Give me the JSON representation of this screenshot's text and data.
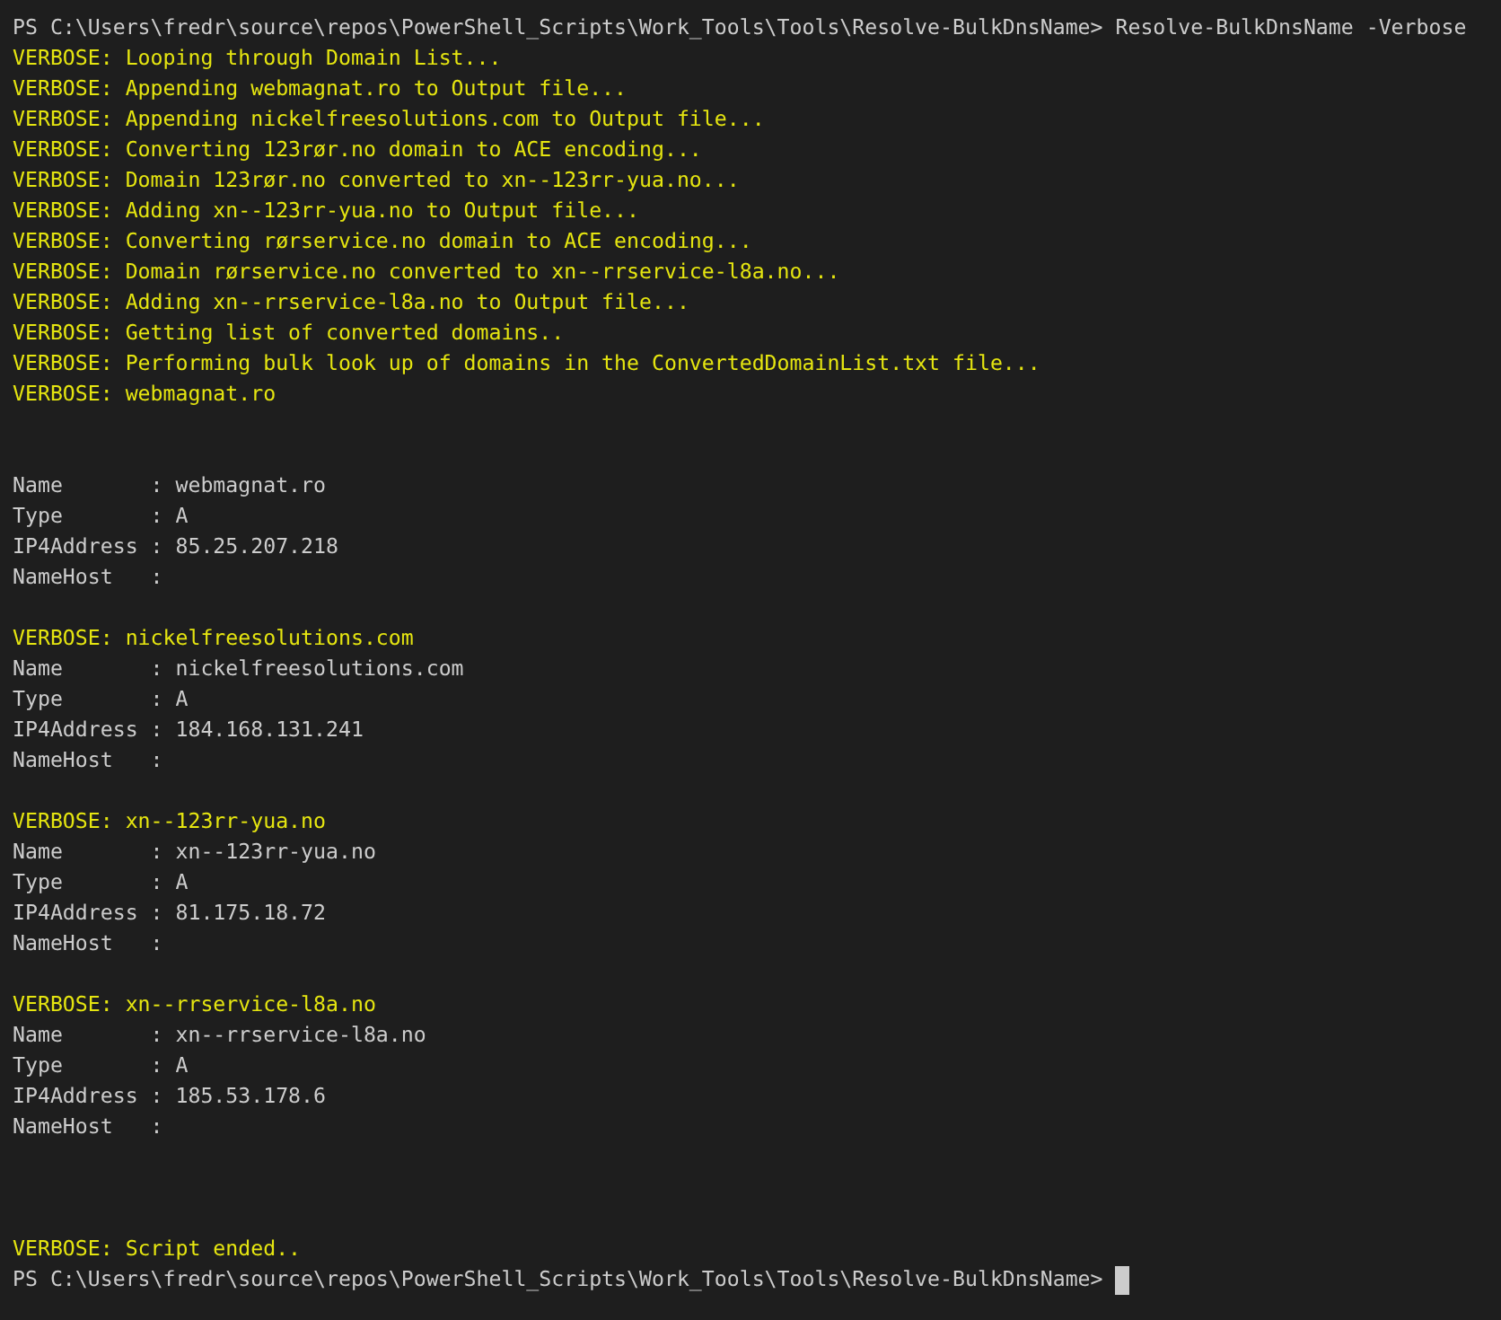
{
  "terminal": {
    "lines": [
      {
        "kind": "prompt",
        "text": "PS C:\\Users\\fredr\\source\\repos\\PowerShell_Scripts\\Work_Tools\\Tools\\Resolve-BulkDnsName> Resolve-BulkDnsName -Verbose"
      },
      {
        "kind": "verbose",
        "text": "VERBOSE: Looping through Domain List..."
      },
      {
        "kind": "verbose",
        "text": "VERBOSE: Appending webmagnat.ro to Output file..."
      },
      {
        "kind": "verbose",
        "text": "VERBOSE: Appending nickelfreesolutions.com to Output file..."
      },
      {
        "kind": "verbose",
        "text": "VERBOSE: Converting 123rør.no domain to ACE encoding..."
      },
      {
        "kind": "verbose",
        "text": "VERBOSE: Domain 123rør.no converted to xn--123rr-yua.no..."
      },
      {
        "kind": "verbose",
        "text": "VERBOSE: Adding xn--123rr-yua.no to Output file..."
      },
      {
        "kind": "verbose",
        "text": "VERBOSE: Converting rørservice.no domain to ACE encoding..."
      },
      {
        "kind": "verbose",
        "text": "VERBOSE: Domain rørservice.no converted to xn--rrservice-l8a.no..."
      },
      {
        "kind": "verbose",
        "text": "VERBOSE: Adding xn--rrservice-l8a.no to Output file..."
      },
      {
        "kind": "verbose",
        "text": "VERBOSE: Getting list of converted domains.."
      },
      {
        "kind": "verbose",
        "text": "VERBOSE: Performing bulk look up of domains in the ConvertedDomainList.txt file..."
      },
      {
        "kind": "verbose",
        "text": "VERBOSE: webmagnat.ro"
      },
      {
        "kind": "blank"
      },
      {
        "kind": "blank"
      },
      {
        "kind": "output",
        "text": "Name       : webmagnat.ro"
      },
      {
        "kind": "output",
        "text": "Type       : A"
      },
      {
        "kind": "output",
        "text": "IP4Address : 85.25.207.218"
      },
      {
        "kind": "output",
        "text": "NameHost   :"
      },
      {
        "kind": "blank"
      },
      {
        "kind": "verbose",
        "text": "VERBOSE: nickelfreesolutions.com"
      },
      {
        "kind": "output",
        "text": "Name       : nickelfreesolutions.com"
      },
      {
        "kind": "output",
        "text": "Type       : A"
      },
      {
        "kind": "output",
        "text": "IP4Address : 184.168.131.241"
      },
      {
        "kind": "output",
        "text": "NameHost   :"
      },
      {
        "kind": "blank"
      },
      {
        "kind": "verbose",
        "text": "VERBOSE: xn--123rr-yua.no"
      },
      {
        "kind": "output",
        "text": "Name       : xn--123rr-yua.no"
      },
      {
        "kind": "output",
        "text": "Type       : A"
      },
      {
        "kind": "output",
        "text": "IP4Address : 81.175.18.72"
      },
      {
        "kind": "output",
        "text": "NameHost   :"
      },
      {
        "kind": "blank"
      },
      {
        "kind": "verbose",
        "text": "VERBOSE: xn--rrservice-l8a.no"
      },
      {
        "kind": "output",
        "text": "Name       : xn--rrservice-l8a.no"
      },
      {
        "kind": "output",
        "text": "Type       : A"
      },
      {
        "kind": "output",
        "text": "IP4Address : 185.53.178.6"
      },
      {
        "kind": "output",
        "text": "NameHost   :"
      },
      {
        "kind": "blank"
      },
      {
        "kind": "blank"
      },
      {
        "kind": "blank"
      },
      {
        "kind": "verbose",
        "text": "VERBOSE: Script ended.."
      },
      {
        "kind": "prompt",
        "text": "PS C:\\Users\\fredr\\source\\repos\\PowerShell_Scripts\\Work_Tools\\Tools\\Resolve-BulkDnsName>",
        "cursor": true
      }
    ]
  }
}
